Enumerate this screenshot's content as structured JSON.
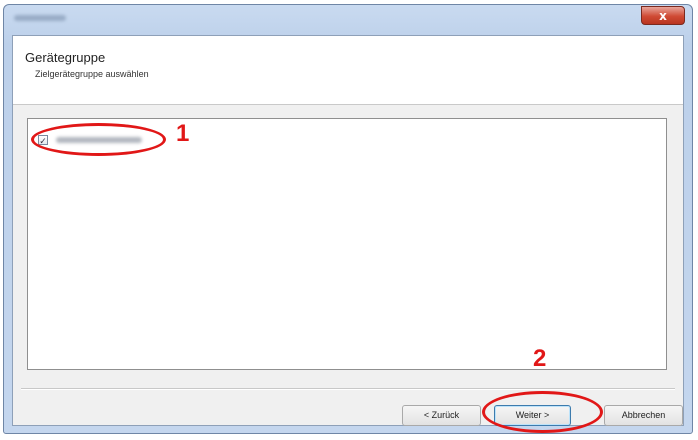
{
  "window": {
    "close_glyph": "x"
  },
  "header": {
    "title": "Gerätegruppe",
    "subtitle": "Zielgerätegruppe auswählen"
  },
  "list": {
    "items": [
      {
        "checked": true,
        "check_glyph": "✓"
      }
    ]
  },
  "buttons": {
    "back": "< Zurück",
    "next": "Weiter >",
    "cancel": "Abbrechen"
  },
  "callouts": {
    "one": "1",
    "two": "2"
  },
  "colors": {
    "callout": "#e11717",
    "close_button": "#cf4a34"
  }
}
